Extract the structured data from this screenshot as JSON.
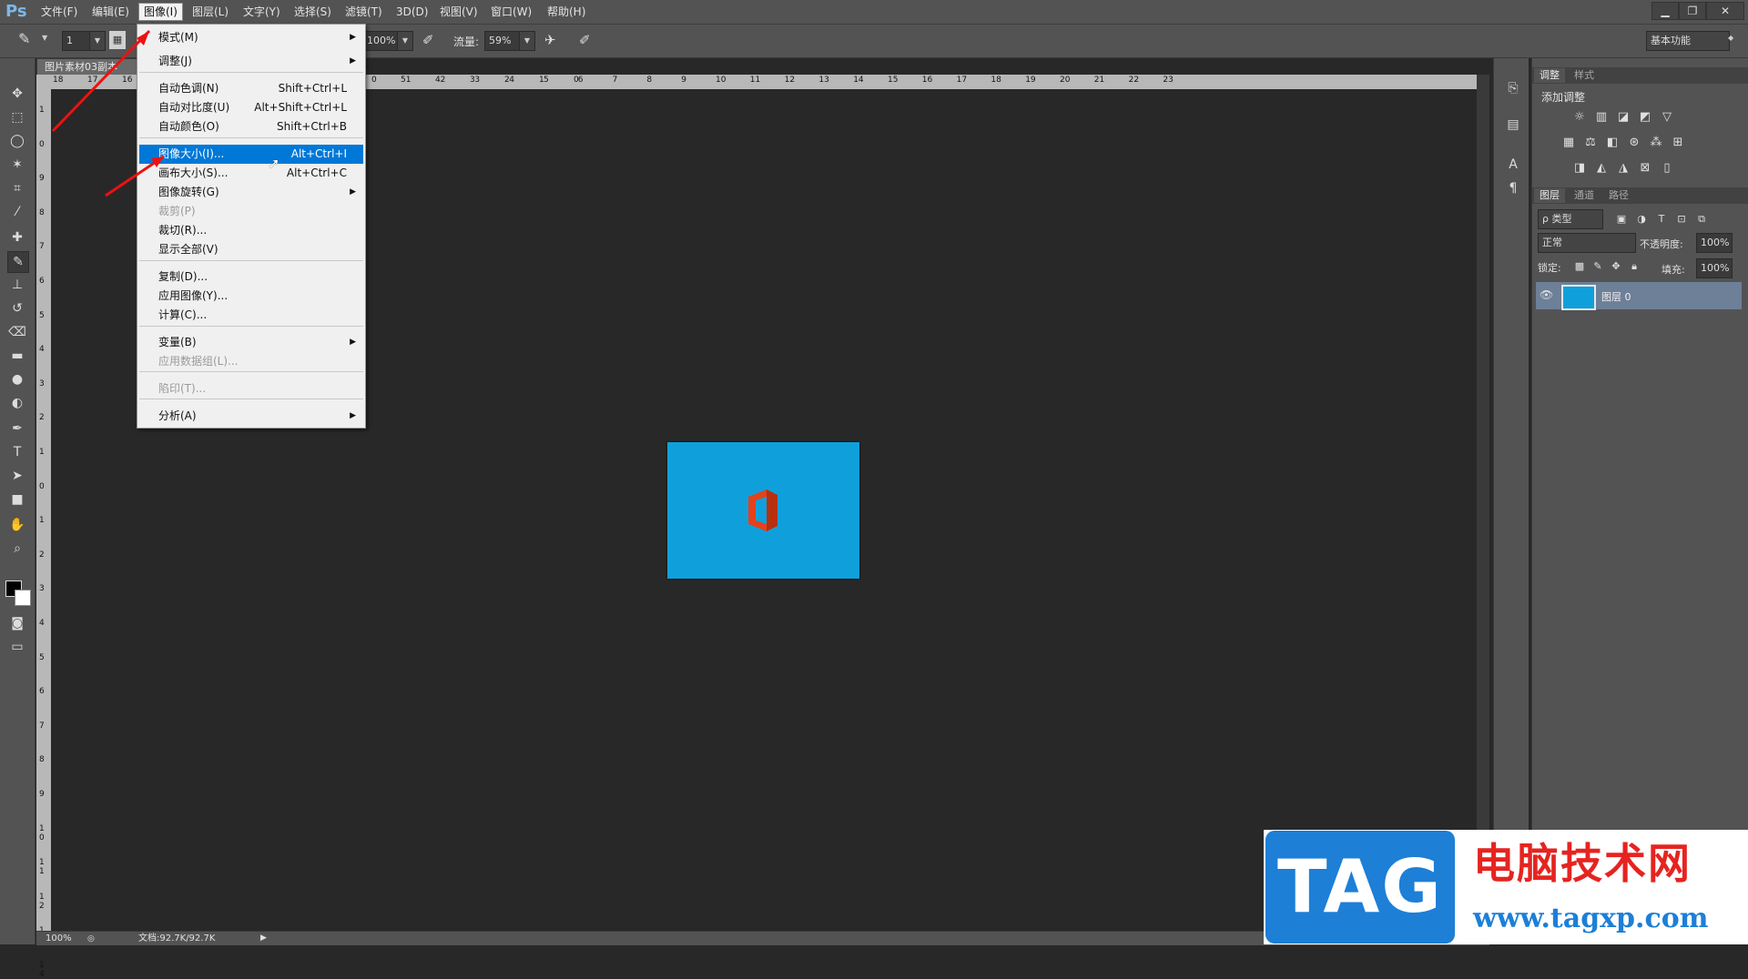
{
  "app": {
    "logo": "Ps"
  },
  "menubar": {
    "items": [
      "文件(F)",
      "编辑(E)",
      "图像(I)",
      "图层(L)",
      "文字(Y)",
      "选择(S)",
      "滤镜(T)",
      "3D(D)",
      "视图(V)",
      "窗口(W)",
      "帮助(H)"
    ],
    "window_buttons": [
      "▁",
      "❐",
      "✕"
    ]
  },
  "options": {
    "brush_size": "1",
    "opacity_value": "100%",
    "flow_label": "流量:",
    "flow_value": "59%",
    "workspace": "基本功能"
  },
  "document": {
    "tab_title": "图片素材03副本",
    "ruler_top": [
      "18",
      "17",
      "16",
      "2",
      "1",
      "0",
      "1",
      "2",
      "3",
      "4",
      "5",
      "6",
      "7",
      "8",
      "9",
      "10",
      "11",
      "12",
      "13",
      "14",
      "15",
      "16",
      "17",
      "18",
      "19",
      "20",
      "21",
      "22",
      "23"
    ],
    "ruler_top_partial": [
      "5",
      "4",
      "3",
      "2",
      "1",
      "0"
    ],
    "ruler_left": [
      "1",
      "0",
      "9",
      "8",
      "7",
      "6",
      "5",
      "4",
      "3",
      "2",
      "1",
      "0",
      "1",
      "2",
      "3",
      "4",
      "5",
      "6",
      "7",
      "8",
      "9",
      "1 0",
      "1 1",
      "1 2",
      "1 3",
      "1 4"
    ],
    "zoom": "100%",
    "doc_info": "文档:92.7K/92.7K"
  },
  "image_menu": {
    "items": [
      {
        "label": "模式(M)",
        "shortcut": "",
        "submenu": true,
        "disabled": false
      },
      {
        "label": "调整(J)",
        "shortcut": "",
        "submenu": true,
        "disabled": false
      },
      {
        "label": "自动色调(N)",
        "shortcut": "Shift+Ctrl+L",
        "submenu": false,
        "disabled": false
      },
      {
        "label": "自动对比度(U)",
        "shortcut": "Alt+Shift+Ctrl+L",
        "submenu": false,
        "disabled": false
      },
      {
        "label": "自动颜色(O)",
        "shortcut": "Shift+Ctrl+B",
        "submenu": false,
        "disabled": false
      },
      {
        "label": "图像大小(I)...",
        "shortcut": "Alt+Ctrl+I",
        "submenu": false,
        "disabled": false,
        "highlighted": true
      },
      {
        "label": "画布大小(S)...",
        "shortcut": "Alt+Ctrl+C",
        "submenu": false,
        "disabled": false
      },
      {
        "label": "图像旋转(G)",
        "shortcut": "",
        "submenu": true,
        "disabled": false
      },
      {
        "label": "裁剪(P)",
        "shortcut": "",
        "submenu": false,
        "disabled": true
      },
      {
        "label": "裁切(R)...",
        "shortcut": "",
        "submenu": false,
        "disabled": false
      },
      {
        "label": "显示全部(V)",
        "shortcut": "",
        "submenu": false,
        "disabled": false
      },
      {
        "label": "复制(D)...",
        "shortcut": "",
        "submenu": false,
        "disabled": false
      },
      {
        "label": "应用图像(Y)...",
        "shortcut": "",
        "submenu": false,
        "disabled": false
      },
      {
        "label": "计算(C)...",
        "shortcut": "",
        "submenu": false,
        "disabled": false
      },
      {
        "label": "变量(B)",
        "shortcut": "",
        "submenu": true,
        "disabled": false
      },
      {
        "label": "应用数据组(L)...",
        "shortcut": "",
        "submenu": false,
        "disabled": true
      },
      {
        "label": "陷印(T)...",
        "shortcut": "",
        "submenu": false,
        "disabled": true
      },
      {
        "label": "分析(A)",
        "shortcut": "",
        "submenu": true,
        "disabled": false
      }
    ]
  },
  "panels": {
    "adjust_tabs": [
      "调整",
      "样式"
    ],
    "adjust_title": "添加调整",
    "layer_tabs": [
      "图层",
      "通道",
      "路径"
    ],
    "kind_filter": "ρ 类型",
    "blend_mode": "正常",
    "opacity_label": "不透明度:",
    "opacity_value": "100%",
    "lock_label": "锁定:",
    "fill_label": "填充:",
    "fill_value": "100%",
    "layer_name": "图层 0"
  },
  "watermark": {
    "tag": "TAG",
    "site_name": "电脑技术网",
    "url": "www.tagxp.com"
  },
  "colors": {
    "accent": "#0078d7",
    "image_fill": "#0fa0dc",
    "office_logo": "#e3421c",
    "watermark_blue": "#1d7fd6",
    "watermark_red": "#e52420"
  }
}
